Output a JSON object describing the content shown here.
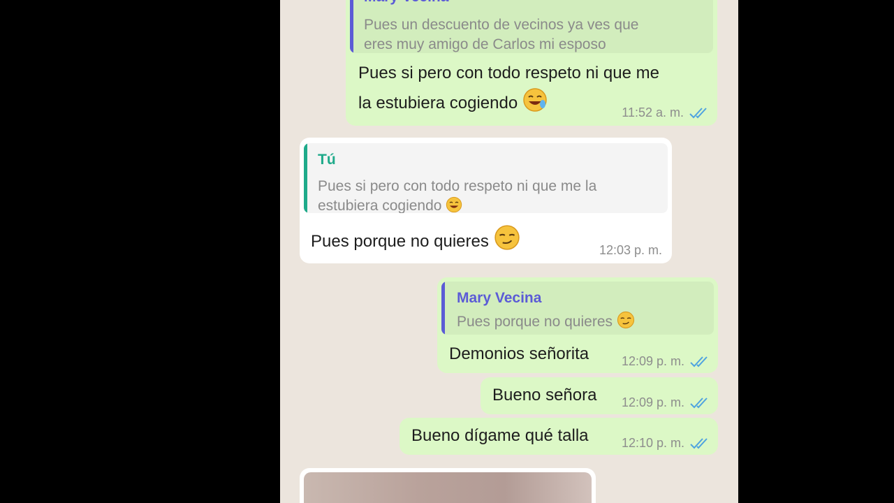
{
  "messages": [
    {
      "quote_name": "Mary Vecina",
      "quote_lines": [
        "Pues un descuento de vecinos ya ves que",
        "eres muy amigo de Carlos mi esposo"
      ],
      "text_lines": [
        "Pues si pero con todo respeto ni que me",
        "la estubiera cogiendo"
      ],
      "emoji": "laughing-face",
      "time": "11:52 a. m."
    },
    {
      "quote_name": "Tú",
      "quote_lines": [
        "Pues si pero con todo respeto ni que me la",
        "estubiera cogiendo"
      ],
      "text": "Pues porque no quieres",
      "emoji": "smirking-face",
      "time": "12:03 p. m."
    },
    {
      "quote_name": "Mary Vecina",
      "quote_text": "Pues porque no quieres",
      "text": "Demonios señorita",
      "time": "12:09 p. m."
    },
    {
      "text": "Bueno señora",
      "time": "12:09 p. m."
    },
    {
      "text": "Bueno dígame qué talla",
      "time": "12:10 p. m."
    }
  ],
  "colors": {
    "outgoing_bubble": "#dcf8c6",
    "incoming_bubble": "#ffffff",
    "chat_background": "#ece5dd",
    "read_ticks": "#4fa3e0",
    "quote_name_self": "#5b5bd6",
    "quote_name_other": "#1faa8a"
  }
}
